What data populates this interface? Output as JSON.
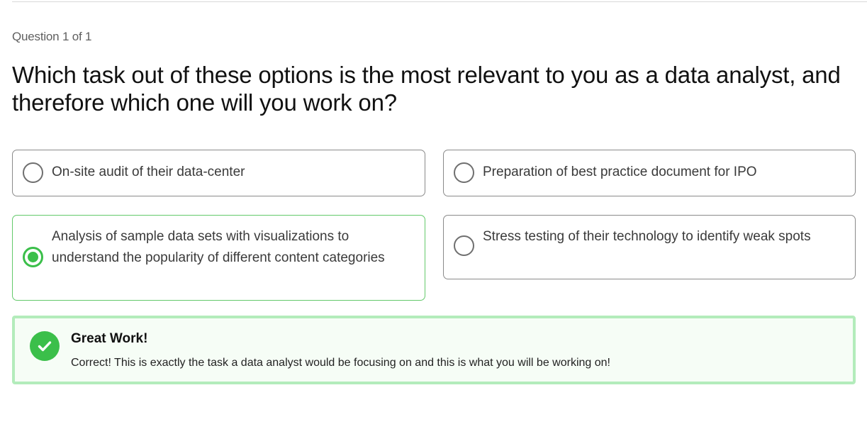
{
  "quiz": {
    "counter": "Question 1 of 1",
    "question": "Which task out of these options is the most relevant to you as a data analyst, and therefore which one will you work on?",
    "options": [
      {
        "label": "On-site audit of their data-center",
        "selected": false
      },
      {
        "label": "Preparation of best practice document for IPO",
        "selected": false
      },
      {
        "label": "Analysis of sample data sets with visualizations to understand the popularity of different content categories",
        "selected": true
      },
      {
        "label": "Stress testing of their technology to identify weak spots",
        "selected": false
      }
    ]
  },
  "feedback": {
    "icon": "checkmark-icon",
    "title": "Great Work!",
    "message": "Correct! This is exactly the task a data analyst would be focusing on and this is what you will be working on!"
  },
  "colors": {
    "accent": "#3bbf4a",
    "selected_border": "#63c96a",
    "feedback_border": "#b3ecbb",
    "feedback_bg": "#f6fdf6"
  }
}
